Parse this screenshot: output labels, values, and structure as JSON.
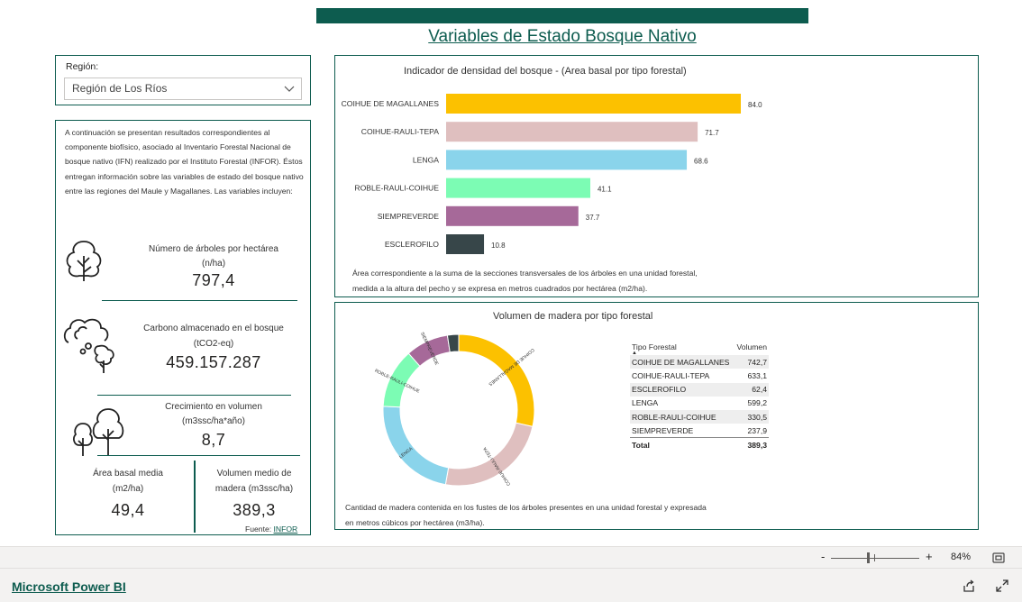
{
  "page_title": "Variables de Estado Bosque Nativo",
  "slicer": {
    "label": "Región:",
    "value": "Región de Los Ríos"
  },
  "description": "A continuación se presentan resultados correspondientes al componente biofísico, asociado al Inventario Forestal Nacional de bosque nativo (IFN) realizado por el Instituto Forestal (INFOR). Éstos entregan información sobre las variables de estado del bosque nativo entre las regiones del Maule y Magallanes. Las variables incluyen:",
  "kpis": {
    "trees": {
      "label1": "Número de árboles por hectárea",
      "label2": "(n/ha)",
      "value": "797,4"
    },
    "carbon": {
      "label1": "Carbono almacenado en el bosque",
      "label2": "(tCO2-eq)",
      "value": "459.157.287"
    },
    "growth": {
      "label1": "Crecimiento en volumen",
      "label2": "(m3ssc/ha*año)",
      "value": "8,7"
    },
    "basal": {
      "label1": "Área basal media",
      "label2": "(m2/ha)",
      "value": "49,4"
    },
    "volume": {
      "label1": "Volumen medio de",
      "label2": "madera (m3ssc/ha)",
      "value": "389,3"
    }
  },
  "source": {
    "prefix": "Fuente: ",
    "link": "INFOR"
  },
  "bar_chart": {
    "title": "Indicador de densidad del bosque -  (Area basal por tipo forestal)",
    "note_line1": "Área correspondiente a la suma de la secciones transversales de los árboles en una unidad forestal,",
    "note_line2": "medida a la altura del pecho y se expresa en metros cuadrados por hectárea (m2/ha)."
  },
  "donut_chart": {
    "title": "Volumen de madera por tipo forestal",
    "note_line1": "Cantidad de madera contenida en los fustes de los árboles presentes en una unidad forestal y expresada",
    "note_line2": "en metros cúbicos por hectárea (m3/ha)."
  },
  "table": {
    "col_type": "Tipo Forestal",
    "col_volume": "Volumen",
    "rows": [
      {
        "type": "COIHUE DE MAGALLANES",
        "volume": "742,7"
      },
      {
        "type": "COIHUE-RAULI-TEPA",
        "volume": "633,1"
      },
      {
        "type": "ESCLEROFILO",
        "volume": "62,4"
      },
      {
        "type": "LENGA",
        "volume": "599,2"
      },
      {
        "type": "ROBLE-RAULI-COIHUE",
        "volume": "330,5"
      },
      {
        "type": "SIEMPREVERDE",
        "volume": "237,9"
      }
    ],
    "total_label": "Total",
    "total_value": "389,3"
  },
  "chart_data": [
    {
      "type": "bar",
      "orientation": "horizontal",
      "title": "Indicador de densidad del bosque -  (Area basal por tipo forestal)",
      "categories": [
        "COIHUE DE MAGALLANES",
        "COIHUE-RAULI-TEPA",
        "LENGA",
        "ROBLE-RAULI-COIHUE",
        "SIEMPREVERDE",
        "ESCLEROFILO"
      ],
      "values": [
        84.0,
        71.7,
        68.6,
        41.1,
        37.7,
        10.8
      ],
      "value_labels": [
        "84.0",
        "71.7",
        "68.6",
        "41.1",
        "37.7",
        "10.8"
      ],
      "colors": [
        "#fcc100",
        "#dfbfbf",
        "#8ad4eb",
        "#7cfcb4",
        "#a66999",
        "#374649"
      ],
      "xlim": [
        0,
        84
      ]
    },
    {
      "type": "pie",
      "donut": true,
      "title": "Volumen de madera por tipo forestal",
      "categories": [
        "COIHUE DE MAGALLANES",
        "COIHUE-RAULI-TEPA",
        "LENGA",
        "ROBLE-RAULI-COIHUE",
        "SIEMPREVERDE",
        "ESCLEROFILO"
      ],
      "slice_labels": [
        "COIHUE DE MAGALLANES",
        "COIHUE-RAULI-TEPA",
        "LENGA",
        "ROBLE-RAULI-COIHUE",
        "SIEMPREVERDE",
        ""
      ],
      "values": [
        742.7,
        633.1,
        599.2,
        330.5,
        237.9,
        62.4
      ],
      "colors": [
        "#fcc100",
        "#dfbfbf",
        "#8ad4eb",
        "#7cfcb4",
        "#a66999",
        "#374649"
      ]
    }
  ],
  "zoom": {
    "minus": "-",
    "plus": "+",
    "level": "84%"
  },
  "footer": {
    "brand": "Microsoft Power BI"
  }
}
